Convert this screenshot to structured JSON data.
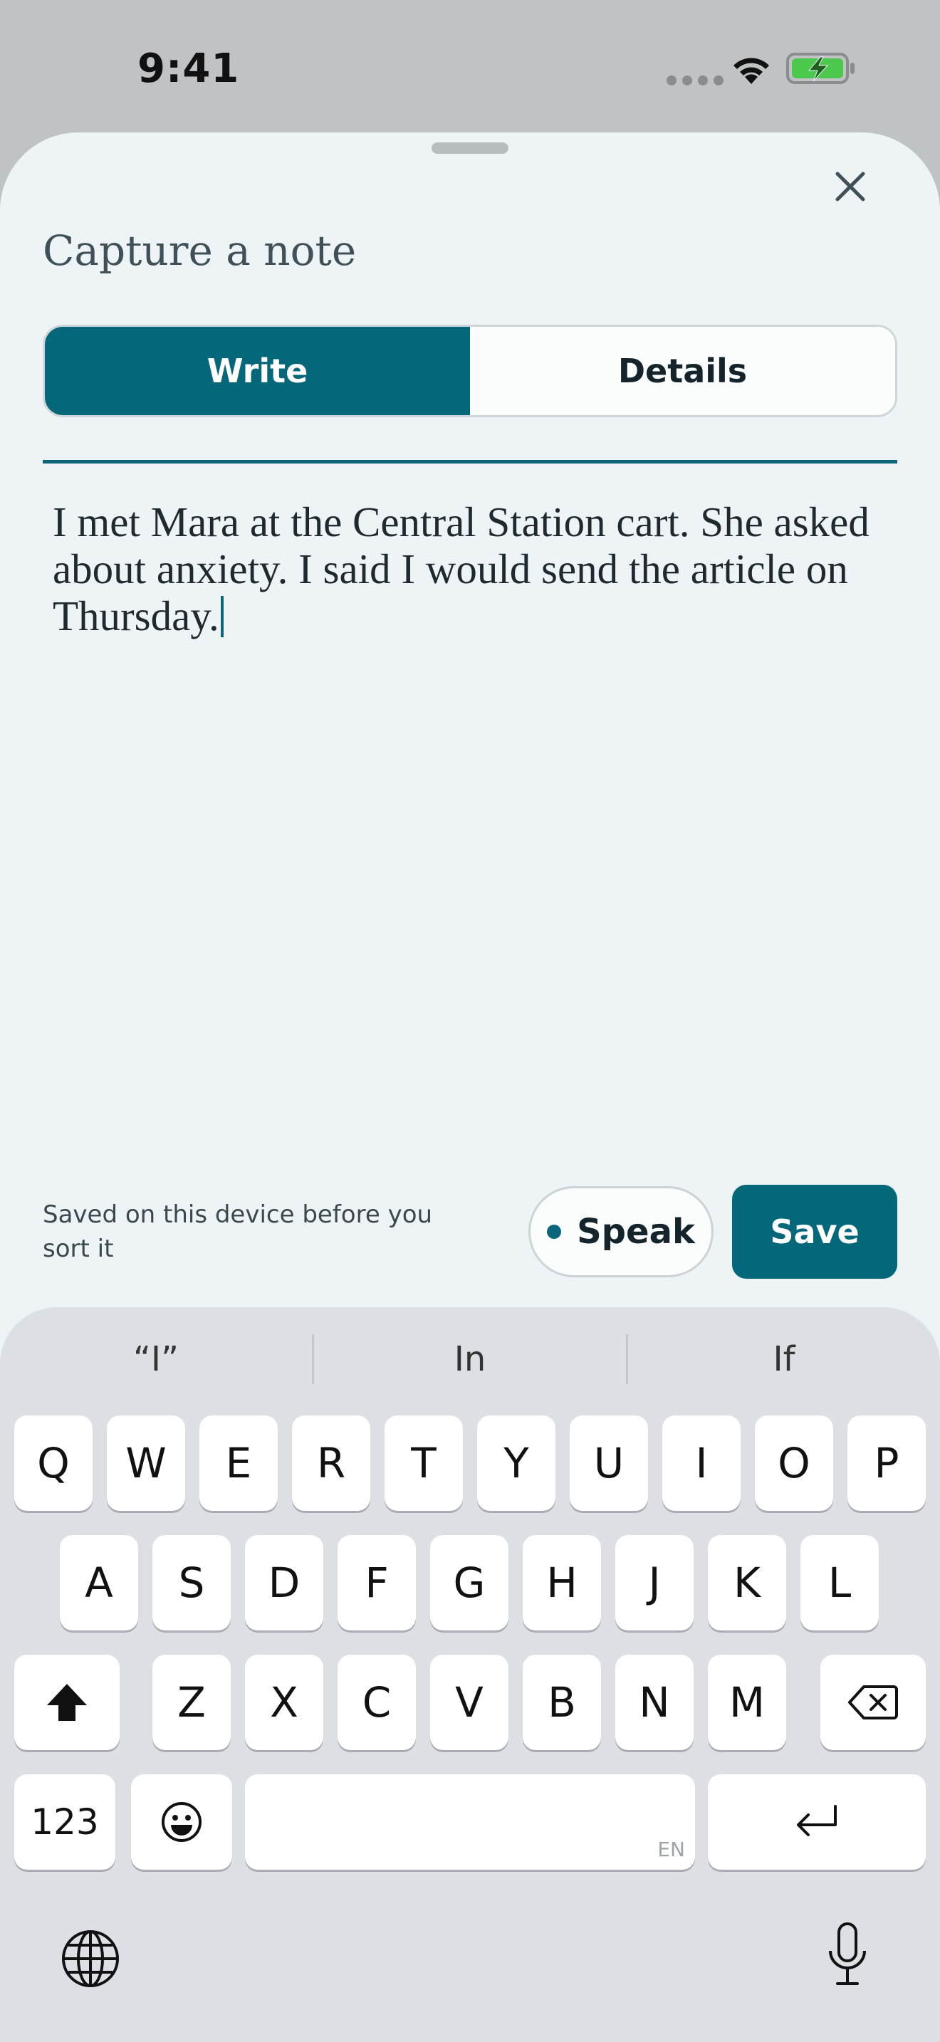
{
  "status_bar": {
    "time": "9:41"
  },
  "sheet": {
    "title": "Capture a note",
    "tabs": [
      {
        "label": "Write",
        "active": true
      },
      {
        "label": "Details",
        "active": false
      }
    ],
    "note_text": "I met Mara at the Central Station cart. She asked about anxiety. I said I would send the article on Thursday.",
    "saved_caption": "Saved on this device before you sort it",
    "speak_label": "Speak",
    "save_label": "Save"
  },
  "keyboard": {
    "suggestions": [
      "“I”",
      "In",
      "If"
    ],
    "row1": [
      "Q",
      "W",
      "E",
      "R",
      "T",
      "Y",
      "U",
      "I",
      "O",
      "P"
    ],
    "row2": [
      "A",
      "S",
      "D",
      "F",
      "G",
      "H",
      "J",
      "K",
      "L"
    ],
    "row3": [
      "Z",
      "X",
      "C",
      "V",
      "B",
      "N",
      "M"
    ],
    "numbers_label": "123",
    "space_language": "EN"
  },
  "colors": {
    "accent": "#05677a",
    "sheet_bg": "#eef4f6",
    "keyboard_bg": "#dcdfe4",
    "battery_green": "#4cc94c"
  },
  "icons": {
    "close": "close-icon",
    "wifi": "wifi-icon",
    "battery": "battery-charging-icon",
    "shift": "shift-icon",
    "delete": "delete-icon",
    "emoji": "emoji-icon",
    "return": "return-icon",
    "globe": "globe-icon",
    "mic": "microphone-icon"
  }
}
